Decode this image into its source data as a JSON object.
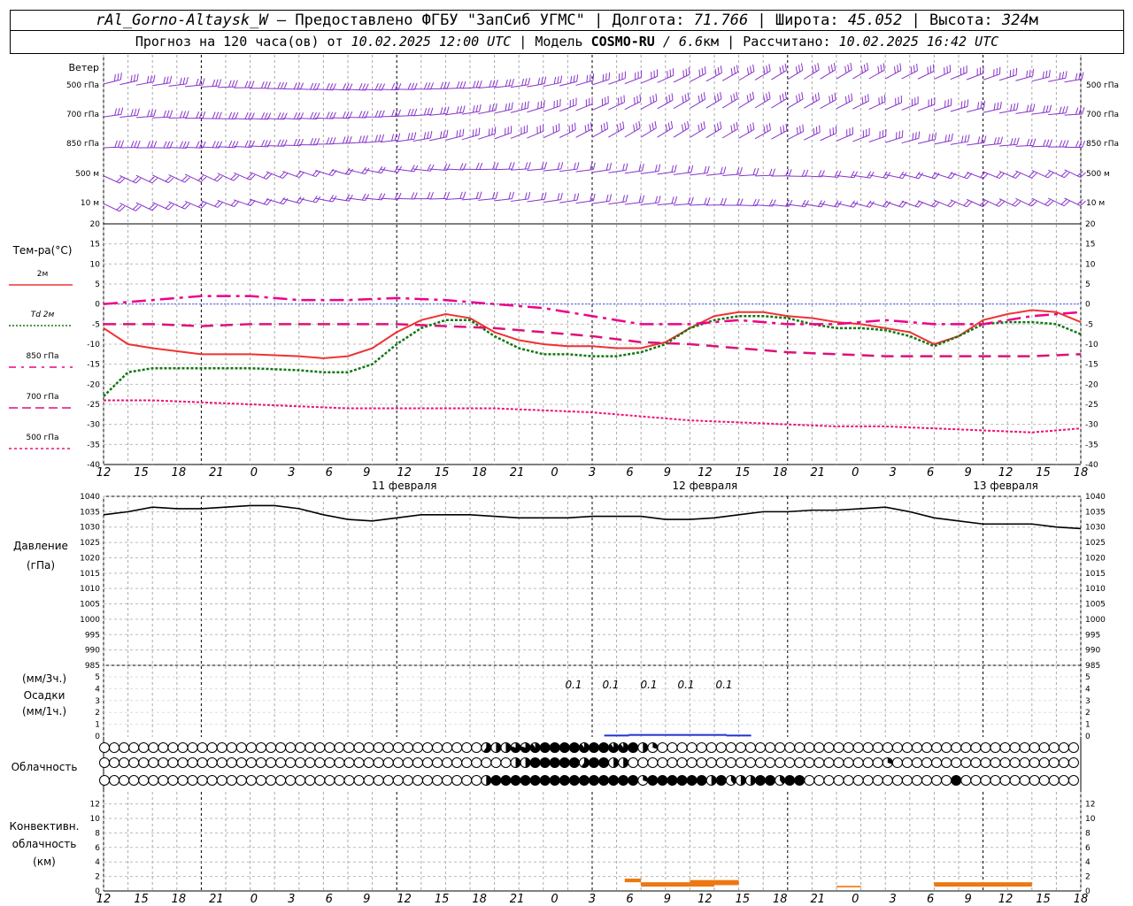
{
  "header": {
    "station": "rAl_Gorno-Altaysk_W",
    "dash": "–",
    "provider": "Предоставлено ФГБУ \"ЗапСиб УГМС\"",
    "lon_label": "Долгота:",
    "lon_value": "71.766",
    "lat_label": "Широта:",
    "lat_value": "45.052",
    "alt_label": "Высота:",
    "alt_value": "324",
    "alt_unit": "м",
    "forecast_label": "Прогноз на 120 часа(ов) от",
    "forecast_time": "10.02.2025 12:00 UTC",
    "model_label": "Модель",
    "model_value": "COSMO-RU",
    "model_res": "/ 6.6",
    "model_res_unit": "км",
    "calc_label": "Рассчитано:",
    "calc_time": "10.02.2025 16:42 UTC"
  },
  "time_axis": {
    "hour_labels": [
      "12",
      "15",
      "18",
      "21",
      "0",
      "3",
      "6",
      "9",
      "12",
      "15",
      "18",
      "21",
      "0",
      "3",
      "6",
      "9",
      "12",
      "15",
      "18",
      "21",
      "0",
      "3",
      "6",
      "9",
      "12",
      "15",
      "18"
    ],
    "date_labels": [
      {
        "text": "11 февраля",
        "at_tick": 8
      },
      {
        "text": "12 февраля",
        "at_tick": 16
      },
      {
        "text": "13 февраля",
        "at_tick": 24
      }
    ]
  },
  "panels": {
    "wind": {
      "title": "Ветер",
      "levels": [
        "500 гПа",
        "700 гПа",
        "850 гПа",
        "500 м",
        "10 м"
      ]
    },
    "temperature": {
      "title": "Тем-ра(°С)",
      "legend": [
        "2м",
        "Td 2м",
        "850 гПа",
        "700 гПа",
        "500 гПа"
      ],
      "ticks": [
        "20",
        "15",
        "10",
        "5",
        "0",
        "-5",
        "-10",
        "-15",
        "-20",
        "-25",
        "-30",
        "-35",
        "-40"
      ]
    },
    "pressure": {
      "title_line1": "Давление",
      "title_line2": "(гПа)",
      "ticks": [
        "1040",
        "1035",
        "1030",
        "1025",
        "1020",
        "1015",
        "1010",
        "1005",
        "1000",
        "995",
        "990",
        "985"
      ]
    },
    "precip": {
      "title_line1": "(мм/3ч.)",
      "title_line2": "Осадки",
      "title_line3": "(мм/1ч.)",
      "ticks": [
        "5",
        "4",
        "3",
        "2",
        "1",
        "0"
      ],
      "annotations": [
        "0.1",
        "0.1",
        "0.1",
        "0.1",
        "0.1"
      ]
    },
    "cloud": {
      "title": "Облачность"
    },
    "convective": {
      "title_line1": "Конвективн.",
      "title_line2": "облачность",
      "title_line3": "(км)",
      "ticks": [
        "12",
        "10",
        "8",
        "6",
        "4",
        "2",
        "0"
      ]
    }
  },
  "colors": {
    "t2m": "#ee3333",
    "td2m": "#117711",
    "t850": "#ee0088",
    "t700": "#dd1177",
    "t500": "#ee1177",
    "wind": "#8833cc",
    "pressure": "#000000",
    "precip": "#2233cc",
    "convective": "#ee7711",
    "zero_line": "#2244ff"
  },
  "chart_data": [
    {
      "type": "line",
      "title": "Тем-ра(°С)",
      "x_unit": "hours since 10.02.2025 12:00 UTC",
      "ylim": [
        -40,
        20
      ],
      "series": [
        {
          "name": "2м",
          "x": [
            0,
            3,
            6,
            12,
            18,
            24,
            27,
            30,
            33,
            36,
            39,
            42,
            45,
            48,
            51,
            54,
            57,
            60,
            63,
            66,
            69,
            72,
            75,
            78,
            81,
            84,
            87,
            90,
            93,
            96,
            99,
            102,
            105,
            108,
            111,
            114,
            117,
            120
          ],
          "values": [
            -6,
            -10,
            -11,
            -12.5,
            -12.5,
            -13,
            -13.5,
            -13,
            -11,
            -7,
            -4,
            -2.5,
            -3.5,
            -7,
            -9,
            -10,
            -10.5,
            -10.5,
            -11,
            -11,
            -9.5,
            -6,
            -3,
            -2,
            -2,
            -3,
            -3.5,
            -4.5,
            -5,
            -6,
            -7,
            -10,
            -8,
            -4,
            -2.5,
            -1.5,
            -2,
            -4.5
          ]
        },
        {
          "name": "Td 2м",
          "x": [
            0,
            3,
            6,
            12,
            18,
            24,
            27,
            30,
            33,
            36,
            39,
            42,
            45,
            48,
            51,
            54,
            57,
            60,
            63,
            66,
            69,
            72,
            75,
            78,
            81,
            84,
            87,
            90,
            93,
            96,
            99,
            102,
            105,
            108,
            111,
            114,
            117,
            120
          ],
          "values": [
            -23,
            -17,
            -16,
            -16,
            -16,
            -16.5,
            -17,
            -17,
            -15,
            -10,
            -6,
            -4,
            -4,
            -8,
            -11,
            -12.5,
            -12.5,
            -13,
            -13,
            -12,
            -10,
            -6,
            -4,
            -3,
            -3,
            -3.5,
            -5,
            -6,
            -6,
            -6.5,
            -8,
            -10.5,
            -8,
            -5,
            -4.5,
            -4.5,
            -5,
            -7.5
          ]
        },
        {
          "name": "850 гПа",
          "x": [
            0,
            6,
            12,
            18,
            24,
            30,
            36,
            42,
            48,
            54,
            60,
            66,
            72,
            78,
            84,
            90,
            96,
            102,
            108,
            114,
            120
          ],
          "values": [
            0,
            1,
            2,
            2,
            1,
            1,
            1.5,
            1,
            0,
            -1,
            -3,
            -5,
            -5,
            -4,
            -5,
            -5,
            -4,
            -5,
            -5,
            -3,
            -2
          ]
        },
        {
          "name": "700 гПа",
          "x": [
            0,
            6,
            12,
            18,
            24,
            30,
            36,
            42,
            48,
            54,
            60,
            66,
            72,
            78,
            84,
            90,
            96,
            102,
            108,
            114,
            120
          ],
          "values": [
            -5,
            -5,
            -5.5,
            -5,
            -5,
            -5,
            -5,
            -5.5,
            -6,
            -7,
            -8,
            -9.5,
            -10,
            -11,
            -12,
            -12.5,
            -13,
            -13,
            -13,
            -13,
            -12.5
          ]
        },
        {
          "name": "500 гПа",
          "x": [
            0,
            6,
            12,
            18,
            24,
            30,
            36,
            42,
            48,
            54,
            60,
            66,
            72,
            78,
            84,
            90,
            96,
            102,
            108,
            114,
            120
          ],
          "values": [
            -24,
            -24,
            -24.5,
            -25,
            -25.5,
            -26,
            -26,
            -26,
            -26,
            -26.5,
            -27,
            -28,
            -29,
            -29.5,
            -30,
            -30.5,
            -30.5,
            -31,
            -31.5,
            -32,
            -31
          ]
        }
      ]
    },
    {
      "type": "line",
      "title": "Давление (гПа)",
      "ylim": [
        985,
        1040
      ],
      "series": [
        {
          "name": "Давление",
          "x": [
            0,
            3,
            6,
            9,
            12,
            15,
            18,
            21,
            24,
            27,
            30,
            33,
            36,
            39,
            42,
            45,
            48,
            51,
            54,
            57,
            60,
            63,
            66,
            69,
            72,
            75,
            78,
            81,
            84,
            87,
            90,
            93,
            96,
            99,
            102,
            105,
            108,
            111,
            114,
            117,
            120
          ],
          "values": [
            1034,
            1035,
            1036.5,
            1036,
            1036,
            1036.5,
            1037,
            1037,
            1036,
            1034,
            1032.5,
            1032,
            1033,
            1034,
            1034,
            1034,
            1033.5,
            1033,
            1033,
            1033,
            1033.5,
            1033.5,
            1033.5,
            1032.5,
            1032.5,
            1033,
            1034,
            1035,
            1035,
            1035.5,
            1035.5,
            1036,
            1036.5,
            1035,
            1033,
            1032,
            1031,
            1031,
            1031,
            1030,
            1029.5
          ]
        }
      ]
    },
    {
      "type": "bar",
      "title": "Осадки (мм/3ч.)",
      "ylim": [
        0,
        5
      ],
      "x": [
        63,
        66,
        69,
        72,
        75,
        78
      ],
      "values": [
        0.05,
        0.1,
        0.1,
        0.1,
        0.1,
        0.05
      ]
    },
    {
      "type": "bar",
      "title": "Конвективн. облачность (км)",
      "ylim": [
        0,
        13
      ],
      "segments": [
        {
          "x0": 64,
          "x1": 66,
          "base": 1.2,
          "top": 1.7
        },
        {
          "x0": 66,
          "x1": 75,
          "base": 0.6,
          "top": 1.2
        },
        {
          "x0": 72,
          "x1": 78,
          "base": 0.8,
          "top": 1.5
        },
        {
          "x0": 90,
          "x1": 93,
          "base": 0.5,
          "top": 0.7
        },
        {
          "x0": 102,
          "x1": 114,
          "base": 0.6,
          "top": 1.2
        }
      ]
    }
  ],
  "clouds": {
    "rows": 3,
    "step_hours": 1,
    "rows_values_note": "coverage fraction 0..1 per hour",
    "row1": [
      [
        0,
        0
      ],
      [
        46,
        0.6
      ],
      [
        48,
        0.5
      ],
      [
        50,
        0.8
      ],
      [
        52,
        0.9
      ],
      [
        54,
        1
      ],
      [
        58,
        0.9
      ],
      [
        60,
        1
      ],
      [
        62,
        0.9
      ],
      [
        64,
        1
      ],
      [
        66,
        0.5
      ],
      [
        67,
        0.3
      ],
      [
        68,
        0
      ],
      [
        120,
        0
      ]
    ],
    "row2": [
      [
        0,
        0
      ],
      [
        50,
        0.5
      ],
      [
        52,
        1
      ],
      [
        58,
        0.6
      ],
      [
        60,
        1
      ],
      [
        62,
        0.5
      ],
      [
        64,
        0
      ],
      [
        96,
        0.3
      ],
      [
        97,
        0
      ],
      [
        120,
        0
      ]
    ],
    "row3": [
      [
        0,
        0
      ],
      [
        46,
        0.5
      ],
      [
        47,
        0.3
      ],
      [
        48,
        1
      ],
      [
        66,
        0.3
      ],
      [
        67,
        1
      ],
      [
        74,
        0.5
      ],
      [
        75,
        1
      ],
      [
        76,
        0.4
      ],
      [
        78,
        0.5
      ],
      [
        80,
        1
      ],
      [
        82,
        0.4
      ],
      [
        84,
        1
      ],
      [
        86,
        0
      ],
      [
        104,
        1
      ],
      [
        105,
        0
      ],
      [
        120,
        0
      ]
    ]
  }
}
